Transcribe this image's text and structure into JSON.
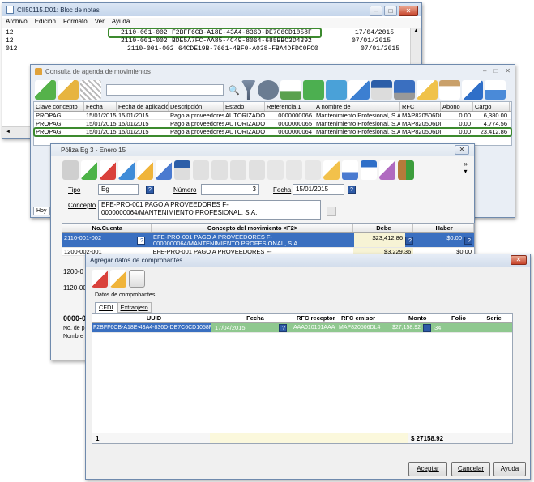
{
  "notepad": {
    "title": "CII50115.D01: Bloc de notas",
    "menu": [
      "Archivo",
      "Edición",
      "Formato",
      "Ver",
      "Ayuda"
    ],
    "lines": [
      {
        "prefix": "12",
        "account": "2110-001-002",
        "uuid": "F2BFF6CB-A18E-43A4-836D-DE7C6CD1058F",
        "date": "17/04/2015"
      },
      {
        "prefix": "12",
        "account": "2110-001-002",
        "uuid": "BDE5A7FC-AA85-4C49-8064-685BBC3D4392",
        "date": "07/01/2015"
      },
      {
        "prefix": "012",
        "account": "2110-001-002",
        "uuid": "64CDE19B-7661-4BF0-A038-FBA4DFDC0FC0",
        "date": "07/01/2015"
      }
    ]
  },
  "agenda": {
    "title": "Consulta de agenda de movimientos",
    "columns": [
      "Clave concepto",
      "Fecha",
      "Fecha de aplicación",
      "Descripción",
      "Estado",
      "Referencia 1",
      "A nombre de",
      "RFC",
      "Abono",
      "Cargo"
    ],
    "rows": [
      [
        "PROPAG",
        "15/01/2015",
        "15/01/2015",
        "Pago a proveedores",
        "AUTORIZADO",
        "0000000066",
        "Mantenimiento Profesional, S.A.",
        "MAP820506DL4",
        "0.00",
        "6,380.00"
      ],
      [
        "PROPAG",
        "15/01/2015",
        "15/01/2015",
        "Pago a proveedores",
        "AUTORIZADO",
        "0000000065",
        "Mantenimiento Profesional, S.A.",
        "MAP820506DL4",
        "0.00",
        "4,774.56"
      ],
      [
        "PROPAG",
        "15/01/2015",
        "15/01/2015",
        "Pago a proveedores",
        "AUTORIZADO",
        "0000000064",
        "Mantenimiento Profesional, S.A.",
        "MAP820506DL4",
        "0.00",
        "23,412.86"
      ]
    ],
    "tabs": [
      "Hoy",
      "En"
    ]
  },
  "poliza": {
    "title": "Póliza Eg   3 - Enero 15",
    "tipo_label": "Tipo",
    "tipo_value": "Eg",
    "numero_label": "Número",
    "numero_value": "3",
    "fecha_label": "Fecha",
    "fecha_value": "15/01/2015",
    "concepto_label": "Concepto",
    "concepto_value": "EFE-PRO-001 PAGO A PROVEEDORES F-     0000000064/MANTENIMIENTO PROFESIONAL, S.A.",
    "grid_headers": [
      "No.Cuenta",
      "Concepto del movimiento <F2>",
      "Debe",
      "Haber"
    ],
    "rows": [
      {
        "cuenta": "2110-001-002",
        "concepto": "EFE-PRO-001 PAGO A PROVEEDORES F-      0000000064/MANTENIMIENTO PROFESIONAL, S.A.",
        "debe": "$23,412.86",
        "haber": "$0.00"
      },
      {
        "cuenta": "1200-002-001",
        "concepto": "EFE-PRO-001 PAGO A PROVEEDORES F-",
        "debe": "$3,229.36",
        "haber": "$0.00"
      }
    ],
    "left_stubs": [
      "1200-0",
      "1120-00"
    ],
    "footer_label": "0000-0",
    "no_label": "No. de p",
    "nombre_label": "Nombre"
  },
  "comprobantes": {
    "title": "Agregar datos de comprobantes",
    "section": "Datos de comprobantes",
    "tabs": [
      "CFDI",
      "Extranjero"
    ],
    "columns": [
      "UUID",
      "Fecha",
      "RFC receptor",
      "RFC emisor",
      "Monto",
      "Folio",
      "Serie"
    ],
    "row": {
      "uuid": "F2BFF6CB-A18E-43A4-836D-DE7C6CD1058F",
      "fecha": "17/04/2015",
      "rfc_receptor": "AAA010101AAA",
      "rfc_emisor": "MAP820506DL4",
      "monto": "$27,158.92",
      "folio": "34",
      "serie": ""
    },
    "footer_count": "1",
    "footer_total": "$ 27158.92",
    "buttons": {
      "accept": "Aceptar",
      "cancel": "Cancelar",
      "help": "Ayuda"
    }
  },
  "colors": {
    "highlight_border": "#3c8a2e",
    "selected_row": "#3a6fc0",
    "cfdi_row": "#8fc88f",
    "window_border": "#6f8aad"
  }
}
